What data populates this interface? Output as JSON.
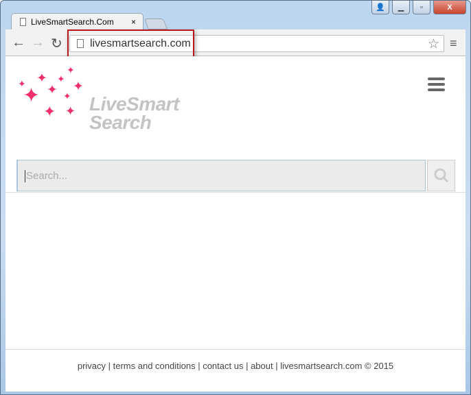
{
  "browser": {
    "tab_title": "LiveSmartSearch.Com",
    "url": "livesmartsearch.com",
    "close_tab": "×"
  },
  "page": {
    "logo_line1": "LiveSmart",
    "logo_line2": "Search",
    "search_placeholder": "Search..."
  },
  "footer": {
    "links": [
      "privacy",
      "terms and conditions",
      "contact us",
      "about",
      "livesmartsearch.com © 2015"
    ],
    "sep": " | "
  },
  "colors": {
    "accent": "#f0306a",
    "highlight": "#b8151b"
  }
}
